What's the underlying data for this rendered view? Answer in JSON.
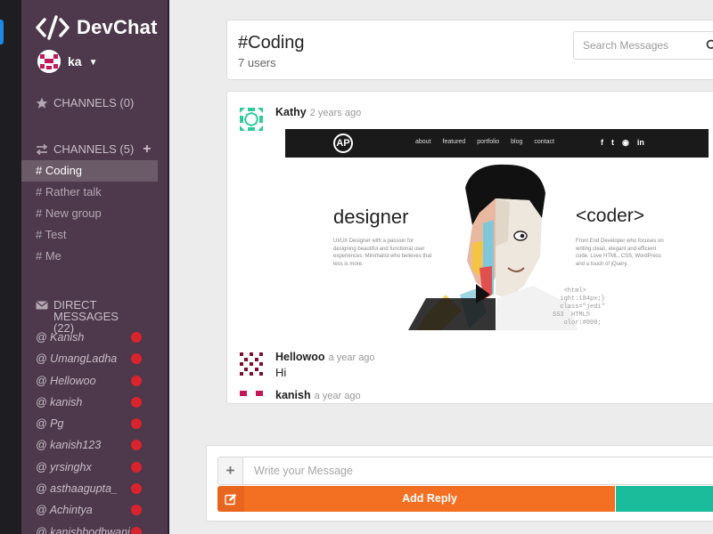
{
  "app": {
    "name": "DevChat",
    "user": "ka"
  },
  "sidebar": {
    "starred_label": "CHANNELS (0)",
    "channels_label": "CHANNELS (5)",
    "channels": [
      "# Coding",
      "# Rather talk",
      "# New group",
      "# Test",
      "# Me"
    ],
    "active_channel": "# Coding",
    "dm_label": "DIRECT MESSAGES (22)",
    "direct_messages": [
      "@ Kanish",
      "@ UmangLadha",
      "@ Hellowoo",
      "@ kanish",
      "@ Pg",
      "@ kanish123",
      "@ yrsinghx",
      "@ asthaagupta_",
      "@ Achintya",
      "@ kanishbodhwani"
    ]
  },
  "header": {
    "title": "#Coding",
    "subtitle": "7 users",
    "search_placeholder": "Search Messages"
  },
  "messages": [
    {
      "user": "Kathy",
      "time": "2 years ago",
      "text": "",
      "attachment": {
        "nav_links": [
          "about",
          "featured",
          "portfolio",
          "blog",
          "contact"
        ],
        "social": [
          "f",
          "t",
          "◉",
          "in"
        ],
        "logo": "AP",
        "heading_left": "designer",
        "heading_right": "<coder>",
        "blurb_left": "UI/UX Designer with a passion for designing beautiful and functional user experiences. Minimalist who believes that less is more.",
        "blurb_right": "Front End Developer who focuses on writing clean, elegant and efficient code. Love HTML, CSS, WordPress and a touch of jQuery.",
        "code_snippet": "   <html>\n  ight:184px;}\n  class=\"jedi\"\nSS3  HTML5\n   olor:#000;"
      }
    },
    {
      "user": "Hellowoo",
      "time": "a year ago",
      "text": "Hi"
    },
    {
      "user": "kanish",
      "time": "a year ago",
      "text": ""
    }
  ],
  "reply": {
    "placeholder": "Write your Message",
    "add_reply_label": "Add Reply"
  },
  "colors": {
    "sidebar_bg": "#4d394b",
    "active_channel_bg": "#6b5b69",
    "unread_dot": "#d9232d",
    "add_reply": "#f36f21",
    "teal": "#1abc9c"
  }
}
